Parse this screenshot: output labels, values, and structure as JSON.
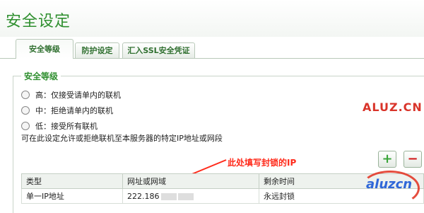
{
  "page": {
    "title": "安全设定"
  },
  "tabs": [
    {
      "label": "安全等级",
      "active": true
    },
    {
      "label": "防护设定",
      "active": false
    },
    {
      "label": "汇入SSL安全凭证",
      "active": false
    }
  ],
  "security_level": {
    "legend": "安全等级",
    "options": [
      {
        "label": "高：仅接受请单内的联机"
      },
      {
        "label": "中：拒绝请单内的联机"
      },
      {
        "label": "低：接受所有联机"
      }
    ],
    "hint": "可在此设定允许或拒绝联机至本服务器的特定IP地址或网段"
  },
  "annotation": {
    "text": "此处填写封锁的IP",
    "color": "#ff2a1a"
  },
  "buttons": {
    "add": "+",
    "remove": "−"
  },
  "table": {
    "headers": [
      "类型",
      "网址或网域",
      "剩余时间"
    ],
    "rows": [
      {
        "type": "单一IP地址",
        "address": "222.186",
        "remaining": "永远封锁"
      }
    ]
  },
  "watermarks": {
    "top": "ALUZ.CN",
    "bottom": "aluzcn"
  },
  "colors": {
    "accent_green": "#2f8f2f",
    "annotation_red": "#ff2a1a"
  }
}
